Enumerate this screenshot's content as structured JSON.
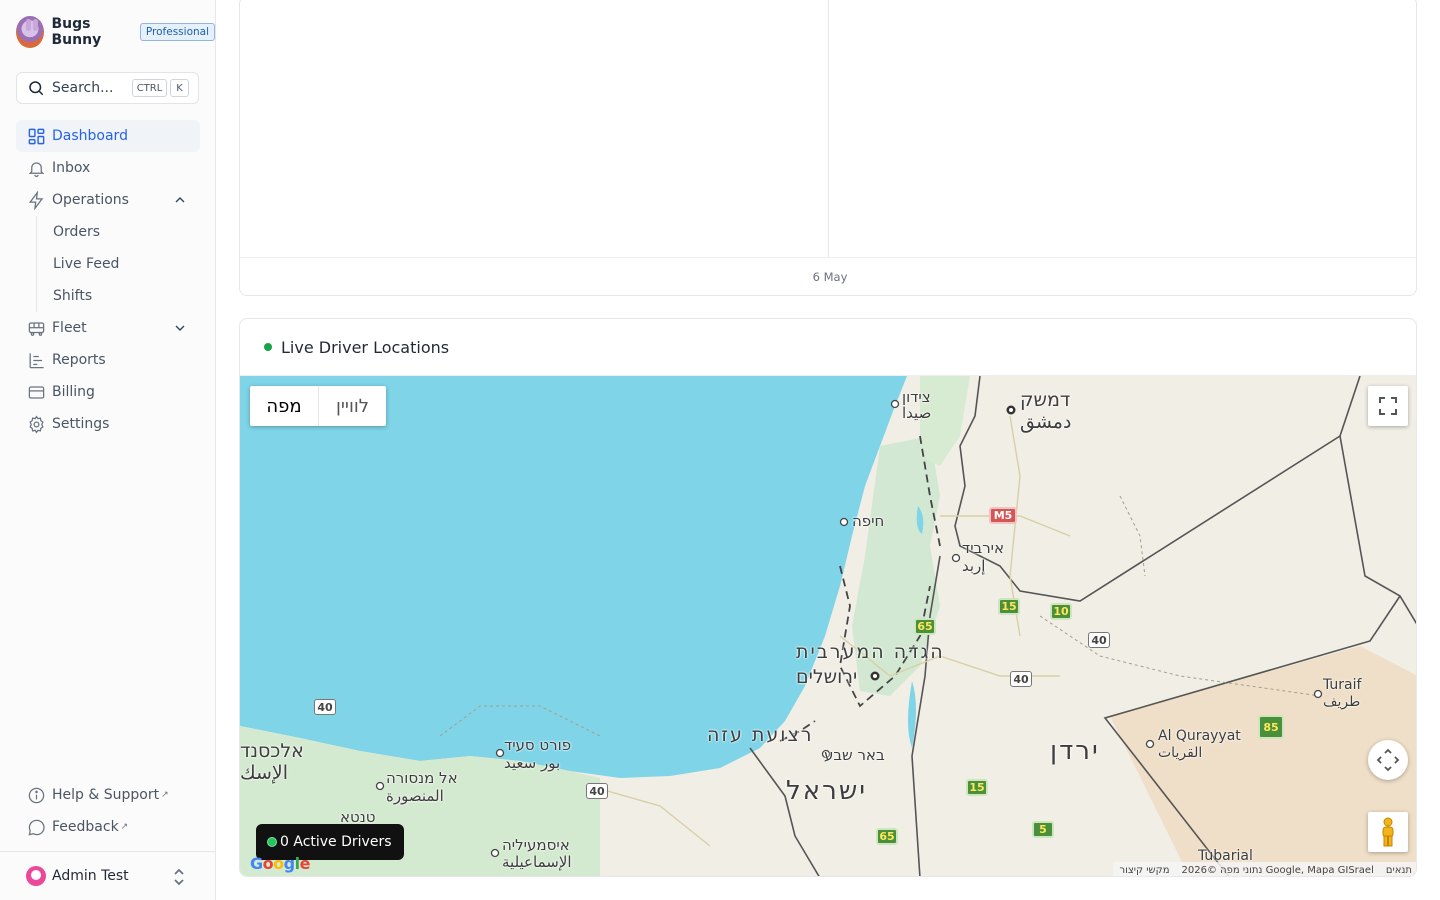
{
  "app": {
    "user_name": "Bugs Bunny",
    "plan_badge": "Professional"
  },
  "search": {
    "label": "Search...",
    "shortcut_ctrl": "CTRL",
    "shortcut_key": "K"
  },
  "sidebar": {
    "items": [
      {
        "label": "Dashboard",
        "icon": "dashboard-icon",
        "active": true
      },
      {
        "label": "Inbox",
        "icon": "bell-icon"
      },
      {
        "label": "Operations",
        "icon": "bolt-icon",
        "expanded": true
      },
      {
        "label": "Orders"
      },
      {
        "label": "Live Feed"
      },
      {
        "label": "Shifts"
      },
      {
        "label": "Fleet",
        "icon": "bus-icon",
        "expanded": false
      },
      {
        "label": "Reports",
        "icon": "reports-icon"
      },
      {
        "label": "Billing",
        "icon": "card-icon"
      },
      {
        "label": "Settings",
        "icon": "gear-icon"
      }
    ],
    "help_label": "Help & Support",
    "feedback_label": "Feedback",
    "current_user": "Admin Test"
  },
  "chart": {
    "x_tick": "6 May"
  },
  "map_card": {
    "title": "Live Driver Locations",
    "map_type_map": "מפה",
    "map_type_satellite": "לוויין",
    "active_drivers": "0 Active Drivers",
    "google_logo": "Google",
    "attribution_terms": "תנאים",
    "attribution_data": "נתוני מפה ©2026 Google, Mapa GISrael",
    "attribution_shortcuts": "מקשי קיצור",
    "labels": {
      "damascus_he": "דמשק",
      "damascus_ar": "دمشق",
      "sidon_he": "צידון",
      "sidon_ar": "صيدا",
      "haifa": "חיפה",
      "irbid_he": "אירביד",
      "irbid_ar": "إربد",
      "west_bank": "הגדה המערבית",
      "jerusalem": "ירושלים",
      "gaza": "רצועת עזה",
      "beersheba": "באר שבע",
      "israel": "ישראל",
      "jordan": "ירדן",
      "alexandria_he": "אלכסנד",
      "alexandria_ar": "الإسك",
      "port_said_he": "פורט סעיד",
      "port_said_ar": "بور سعيد",
      "mansoura_he": "אל מנסורה",
      "mansoura_ar": "المنصورة",
      "tanta": "טנטא",
      "ismailia_he": "איסמעיליה",
      "ismailia_ar": "الإسماعيلية",
      "qurayyat_en": "Al Qurayyat",
      "qurayyat_ar": "القريات",
      "turaif_en": "Turaif",
      "turaif_ar": "طريف",
      "tubarial": "Tubarial"
    },
    "road_shields": {
      "m5": "M5",
      "r40a": "40",
      "r40b": "40",
      "r40c": "40",
      "r40d": "40",
      "r15a": "15",
      "r15b": "15",
      "r10": "10",
      "r65a": "65",
      "r65b": "65",
      "r5": "5",
      "r85": "85"
    }
  }
}
